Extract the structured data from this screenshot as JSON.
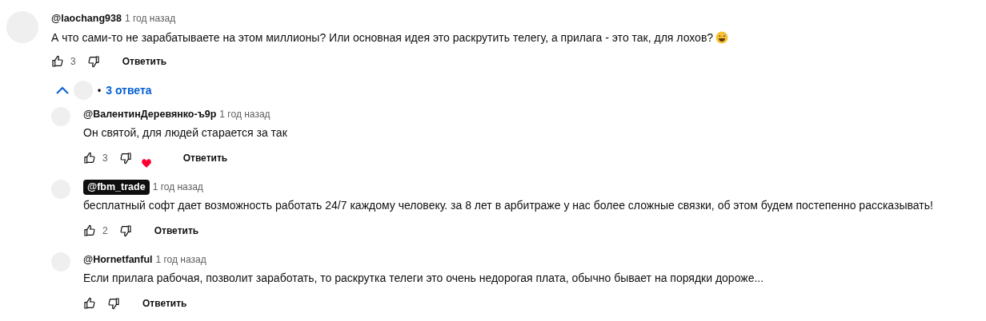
{
  "comment": {
    "author": "@laochang938",
    "owner": false,
    "time": "1 год назад",
    "text": "А что сами-то не зарабатываете на этом миллионы? Или основная идея это раскрутить телегу, а прилага - это так, для лохов?",
    "emoji": true,
    "likes": "3",
    "creator_heart": false,
    "reply_label": "Ответить"
  },
  "replies_toggle": {
    "expanded": true,
    "bullet": "•",
    "label": "3 ответа"
  },
  "replies": [
    {
      "author": "@ВалентинДеревянко-ъ9р",
      "owner": false,
      "time": "1 год назад",
      "text": "Он святой, для людей старается за так",
      "emoji": false,
      "likes": "3",
      "creator_heart": true,
      "reply_label": "Ответить"
    },
    {
      "author": "@fbm_trade",
      "owner": true,
      "time": "1 год назад",
      "text": "бесплатный софт дает возможность работать 24/7 каждому человеку. за 8 лет в арбитраже у нас более сложные связки, об этом будем постепенно рассказывать!",
      "emoji": false,
      "likes": "2",
      "creator_heart": false,
      "reply_label": "Ответить"
    },
    {
      "author": "@Hornetfanful",
      "owner": false,
      "time": "1 год назад",
      "text": "Если прилага рабочая, позволит заработать, то раскрутка телеги это очень недорогая плата, обычно бывает на порядки дороже...",
      "emoji": false,
      "creator_heart": false,
      "reply_label": "Ответить"
    }
  ]
}
